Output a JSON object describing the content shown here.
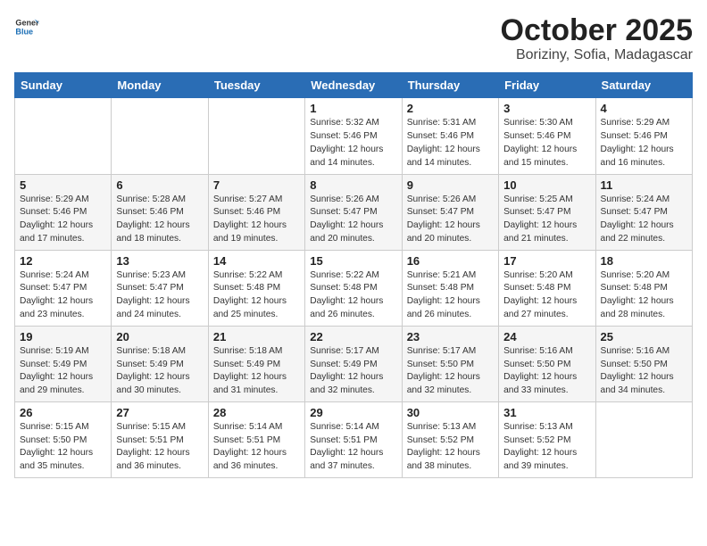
{
  "logo": {
    "general": "General",
    "blue": "Blue"
  },
  "header": {
    "month": "October 2025",
    "location": "Boriziny, Sofia, Madagascar"
  },
  "weekdays": [
    "Sunday",
    "Monday",
    "Tuesday",
    "Wednesday",
    "Thursday",
    "Friday",
    "Saturday"
  ],
  "weeks": [
    [
      {
        "day": "",
        "info": ""
      },
      {
        "day": "",
        "info": ""
      },
      {
        "day": "",
        "info": ""
      },
      {
        "day": "1",
        "info": "Sunrise: 5:32 AM\nSunset: 5:46 PM\nDaylight: 12 hours\nand 14 minutes."
      },
      {
        "day": "2",
        "info": "Sunrise: 5:31 AM\nSunset: 5:46 PM\nDaylight: 12 hours\nand 14 minutes."
      },
      {
        "day": "3",
        "info": "Sunrise: 5:30 AM\nSunset: 5:46 PM\nDaylight: 12 hours\nand 15 minutes."
      },
      {
        "day": "4",
        "info": "Sunrise: 5:29 AM\nSunset: 5:46 PM\nDaylight: 12 hours\nand 16 minutes."
      }
    ],
    [
      {
        "day": "5",
        "info": "Sunrise: 5:29 AM\nSunset: 5:46 PM\nDaylight: 12 hours\nand 17 minutes."
      },
      {
        "day": "6",
        "info": "Sunrise: 5:28 AM\nSunset: 5:46 PM\nDaylight: 12 hours\nand 18 minutes."
      },
      {
        "day": "7",
        "info": "Sunrise: 5:27 AM\nSunset: 5:46 PM\nDaylight: 12 hours\nand 19 minutes."
      },
      {
        "day": "8",
        "info": "Sunrise: 5:26 AM\nSunset: 5:47 PM\nDaylight: 12 hours\nand 20 minutes."
      },
      {
        "day": "9",
        "info": "Sunrise: 5:26 AM\nSunset: 5:47 PM\nDaylight: 12 hours\nand 20 minutes."
      },
      {
        "day": "10",
        "info": "Sunrise: 5:25 AM\nSunset: 5:47 PM\nDaylight: 12 hours\nand 21 minutes."
      },
      {
        "day": "11",
        "info": "Sunrise: 5:24 AM\nSunset: 5:47 PM\nDaylight: 12 hours\nand 22 minutes."
      }
    ],
    [
      {
        "day": "12",
        "info": "Sunrise: 5:24 AM\nSunset: 5:47 PM\nDaylight: 12 hours\nand 23 minutes."
      },
      {
        "day": "13",
        "info": "Sunrise: 5:23 AM\nSunset: 5:47 PM\nDaylight: 12 hours\nand 24 minutes."
      },
      {
        "day": "14",
        "info": "Sunrise: 5:22 AM\nSunset: 5:48 PM\nDaylight: 12 hours\nand 25 minutes."
      },
      {
        "day": "15",
        "info": "Sunrise: 5:22 AM\nSunset: 5:48 PM\nDaylight: 12 hours\nand 26 minutes."
      },
      {
        "day": "16",
        "info": "Sunrise: 5:21 AM\nSunset: 5:48 PM\nDaylight: 12 hours\nand 26 minutes."
      },
      {
        "day": "17",
        "info": "Sunrise: 5:20 AM\nSunset: 5:48 PM\nDaylight: 12 hours\nand 27 minutes."
      },
      {
        "day": "18",
        "info": "Sunrise: 5:20 AM\nSunset: 5:48 PM\nDaylight: 12 hours\nand 28 minutes."
      }
    ],
    [
      {
        "day": "19",
        "info": "Sunrise: 5:19 AM\nSunset: 5:49 PM\nDaylight: 12 hours\nand 29 minutes."
      },
      {
        "day": "20",
        "info": "Sunrise: 5:18 AM\nSunset: 5:49 PM\nDaylight: 12 hours\nand 30 minutes."
      },
      {
        "day": "21",
        "info": "Sunrise: 5:18 AM\nSunset: 5:49 PM\nDaylight: 12 hours\nand 31 minutes."
      },
      {
        "day": "22",
        "info": "Sunrise: 5:17 AM\nSunset: 5:49 PM\nDaylight: 12 hours\nand 32 minutes."
      },
      {
        "day": "23",
        "info": "Sunrise: 5:17 AM\nSunset: 5:50 PM\nDaylight: 12 hours\nand 32 minutes."
      },
      {
        "day": "24",
        "info": "Sunrise: 5:16 AM\nSunset: 5:50 PM\nDaylight: 12 hours\nand 33 minutes."
      },
      {
        "day": "25",
        "info": "Sunrise: 5:16 AM\nSunset: 5:50 PM\nDaylight: 12 hours\nand 34 minutes."
      }
    ],
    [
      {
        "day": "26",
        "info": "Sunrise: 5:15 AM\nSunset: 5:50 PM\nDaylight: 12 hours\nand 35 minutes."
      },
      {
        "day": "27",
        "info": "Sunrise: 5:15 AM\nSunset: 5:51 PM\nDaylight: 12 hours\nand 36 minutes."
      },
      {
        "day": "28",
        "info": "Sunrise: 5:14 AM\nSunset: 5:51 PM\nDaylight: 12 hours\nand 36 minutes."
      },
      {
        "day": "29",
        "info": "Sunrise: 5:14 AM\nSunset: 5:51 PM\nDaylight: 12 hours\nand 37 minutes."
      },
      {
        "day": "30",
        "info": "Sunrise: 5:13 AM\nSunset: 5:52 PM\nDaylight: 12 hours\nand 38 minutes."
      },
      {
        "day": "31",
        "info": "Sunrise: 5:13 AM\nSunset: 5:52 PM\nDaylight: 12 hours\nand 39 minutes."
      },
      {
        "day": "",
        "info": ""
      }
    ]
  ]
}
